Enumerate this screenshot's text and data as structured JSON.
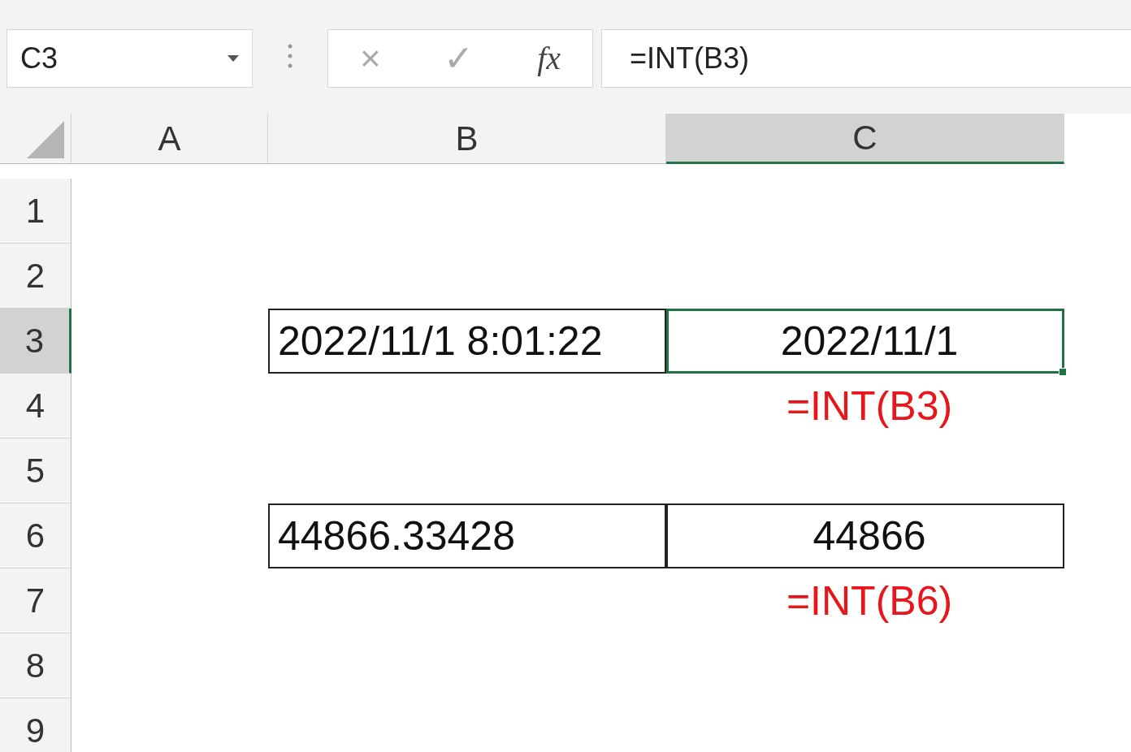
{
  "name_box": {
    "value": "C3"
  },
  "formula_bar": {
    "cancel": "×",
    "enter": "✓",
    "function": "fx",
    "value": "=INT(B3)"
  },
  "columns": [
    {
      "label": "A",
      "selected": false
    },
    {
      "label": "B",
      "selected": false
    },
    {
      "label": "C",
      "selected": true
    }
  ],
  "rows": [
    {
      "label": "1",
      "selected": false
    },
    {
      "label": "2",
      "selected": false
    },
    {
      "label": "3",
      "selected": true,
      "b": {
        "kind": "boxed",
        "text": "2022/11/1 8:01:22",
        "selected": false
      },
      "c": {
        "kind": "boxed",
        "text": "2022/11/1",
        "selected": true
      }
    },
    {
      "label": "4",
      "selected": false,
      "c": {
        "kind": "note",
        "text": "=INT(B3)"
      }
    },
    {
      "label": "5",
      "selected": false
    },
    {
      "label": "6",
      "selected": false,
      "b": {
        "kind": "boxed",
        "text": "44866.33428",
        "selected": false
      },
      "c": {
        "kind": "boxed",
        "text": "44866",
        "selected": false
      }
    },
    {
      "label": "7",
      "selected": false,
      "c": {
        "kind": "note",
        "text": "=INT(B6)"
      }
    },
    {
      "label": "8",
      "selected": false
    },
    {
      "label": "9",
      "selected": false
    }
  ]
}
